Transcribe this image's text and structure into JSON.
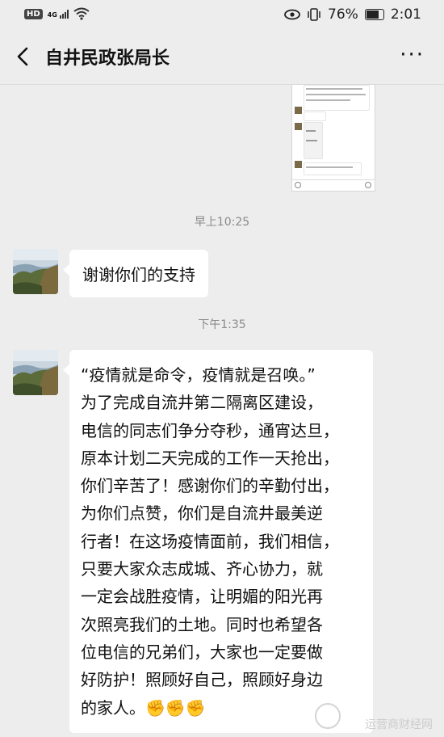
{
  "status_bar": {
    "network": "HD",
    "signal": "4G",
    "battery": "76%",
    "time": "2:01"
  },
  "header": {
    "title": "自井民政张局长"
  },
  "messages": [
    {
      "timestamp": "早上10:25",
      "text": "谢谢你们的支持"
    },
    {
      "timestamp": "下午1:35",
      "text": "“疫情就是命令，疫情就是召唤。”\n为了完成自流井第二隔离区建设，\n电信的同志们争分夺秒，通宵达旦，\n原本计划二天完成的工作一天抢出，\n你们辛苦了！感谢你们的辛勤付出，\n为你们点赞，你们是自流井最美逆\n行者！在这场疫情面前，我们相信，\n只要大家众志成城、齐心协力，就\n一定会战胜疫情，让明媚的阳光再\n次照亮我们的土地。同时也希望各\n位电信的兄弟们，大家也一定要做\n好防护！照顾好自己，照顾好身边\n的家人。✊✊✊"
    }
  ],
  "watermark": "运营商财经网",
  "icons": {
    "back": "chevron-left-icon",
    "more": "more-dots-icon",
    "eye": "eye-icon",
    "vibrate": "vibrate-icon",
    "battery": "battery-icon",
    "wifi": "wifi-icon"
  },
  "colors": {
    "background": "#ededed",
    "bubble": "#ffffff",
    "timestamp": "#8a8a8a"
  }
}
